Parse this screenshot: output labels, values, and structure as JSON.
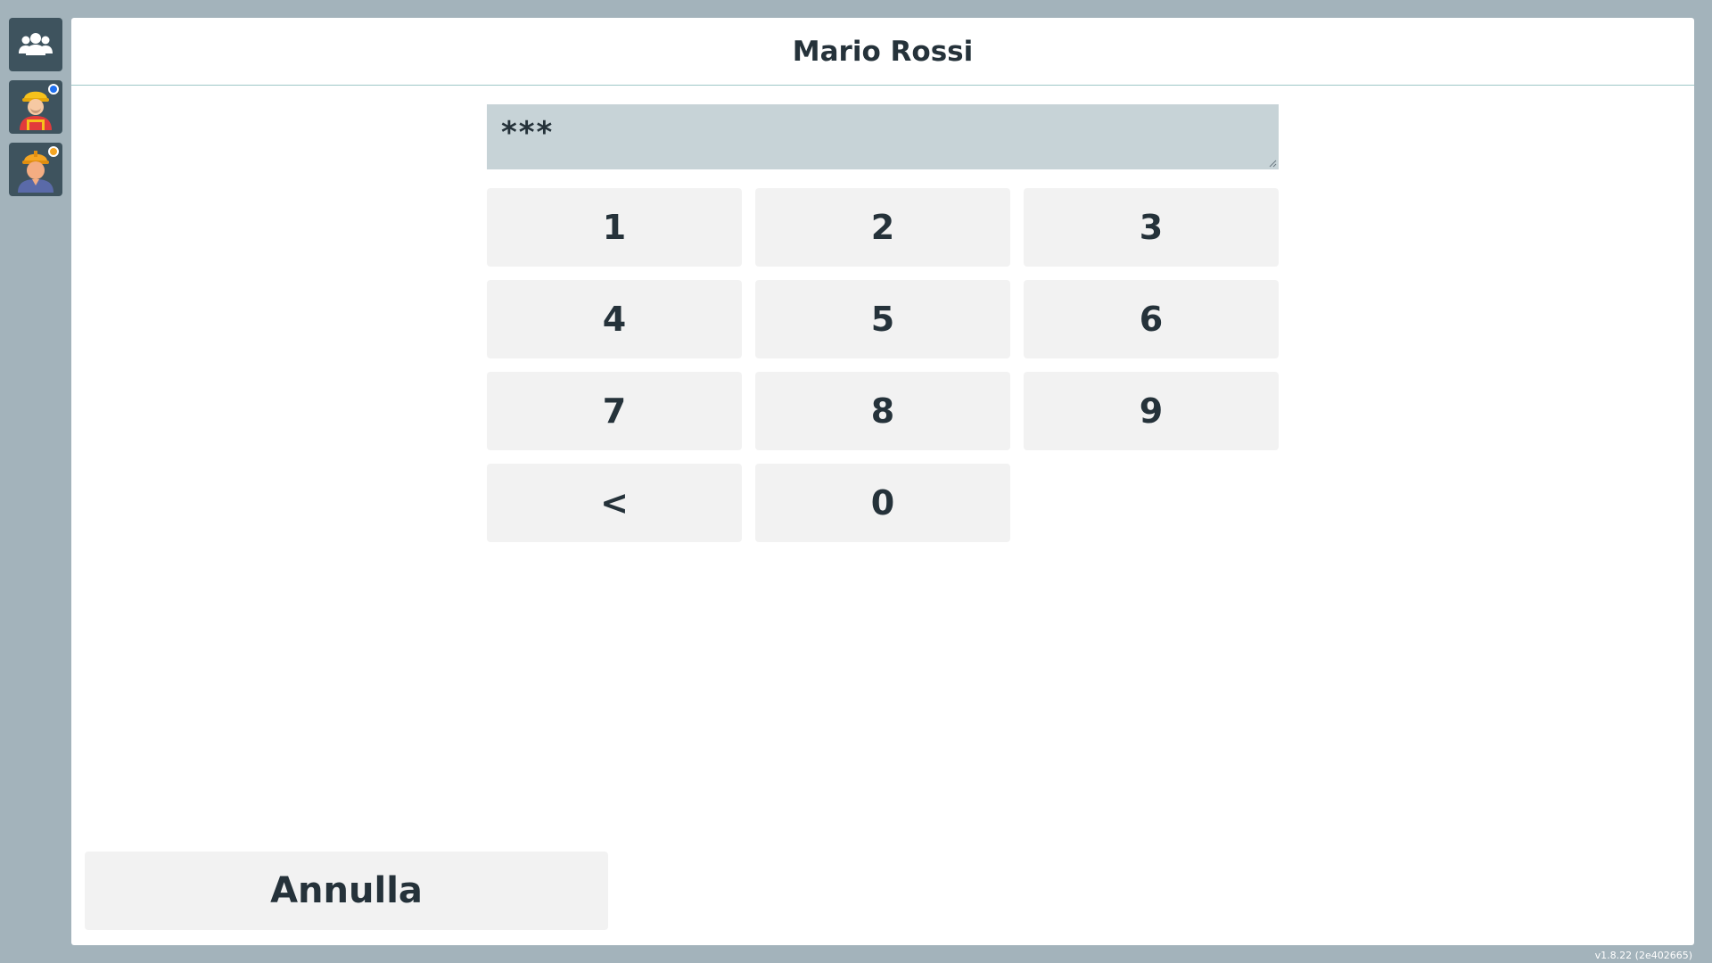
{
  "sidebar": {
    "items": [
      {
        "icon": "users-group-icon"
      },
      {
        "icon": "worker-red-icon",
        "status_color": "#1e6ff0"
      },
      {
        "icon": "worker-blue-icon",
        "status_color": "#f5a623"
      }
    ]
  },
  "header": {
    "title": "Mario Rossi"
  },
  "pin": {
    "value": "***"
  },
  "keypad": {
    "keys": [
      "1",
      "2",
      "3",
      "4",
      "5",
      "6",
      "7",
      "8",
      "9",
      "<",
      "0"
    ]
  },
  "footer": {
    "cancel_label": "Annulla"
  },
  "version": "v1.8.22 (2e402665)",
  "colors": {
    "background": "#a3b3bb",
    "sidebar_button": "#3e535e",
    "pin_field": "#c7d3d7",
    "key": "#f2f2f2",
    "text": "#25323a"
  }
}
